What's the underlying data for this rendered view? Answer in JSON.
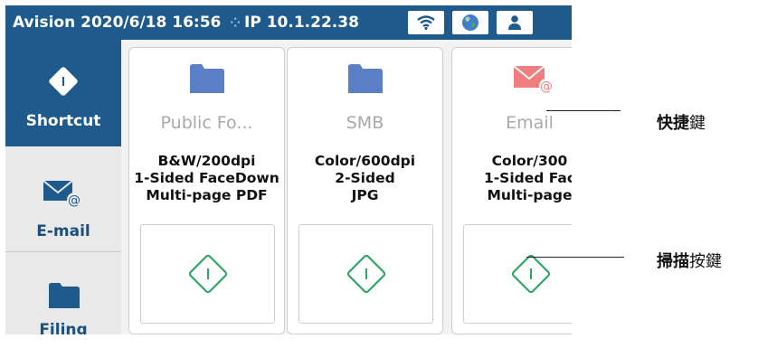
{
  "status_bar": {
    "brand": "Avision",
    "datetime": "2020/6/18 16:56",
    "network_icon": "network-icon",
    "ip_label": "IP 10.1.22.38",
    "buttons": [
      "wifi-icon",
      "globe-icon",
      "user-icon"
    ],
    "bg_color": "#1e5a8c"
  },
  "sidebar": {
    "items": [
      {
        "label": "Shortcut",
        "icon": "diamond-start-icon",
        "active": true
      },
      {
        "label": "E-mail",
        "icon": "email-icon",
        "active": false
      },
      {
        "label": "Filing",
        "icon": "folder-icon",
        "active": false
      }
    ]
  },
  "cards": [
    {
      "title": "Public Fo...",
      "icon": "folder-icon",
      "settings": [
        "B&W/200dpi",
        "1-Sided FaceDown",
        "Multi-page PDF"
      ]
    },
    {
      "title": "SMB",
      "icon": "folder-icon",
      "settings": [
        "Color/600dpi",
        "2-Sided",
        "JPG"
      ]
    },
    {
      "title": "Email",
      "icon": "email-icon",
      "settings": [
        "Color/300",
        "1-Sided Fac",
        "Multi-page"
      ]
    }
  ],
  "annotations": {
    "shortcut_key": {
      "bold": "快捷",
      "normal": "鍵"
    },
    "scan_key": {
      "bold": "掃描",
      "normal": "按鍵"
    }
  },
  "colors": {
    "accent": "#1e5a8c",
    "folder": "#5b7fc7",
    "email": "#ef7f7f",
    "scan_green": "#2ea563"
  }
}
